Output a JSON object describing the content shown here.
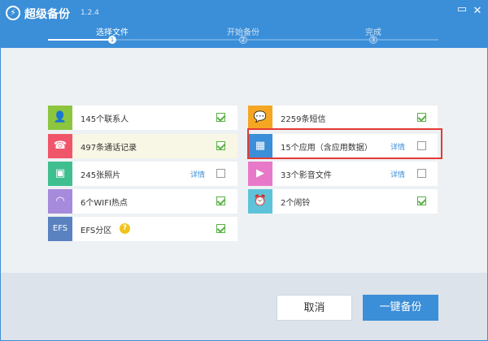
{
  "app": {
    "title": "超级备份",
    "version": "1.2.4",
    "logo": "⚡",
    "minimize_icon": "▭",
    "close_icon": "✕"
  },
  "steps": [
    {
      "label": "选择文件",
      "num": "1"
    },
    {
      "label": "开始备份",
      "num": "2"
    },
    {
      "label": "完成",
      "num": "3"
    }
  ],
  "left_items": [
    {
      "label": "145个联系人",
      "color": "#8cc63f",
      "icon": "contact-icon",
      "glyph": "👤",
      "checked": true
    },
    {
      "label": "497条通话记录",
      "color": "#f0566a",
      "icon": "phone-icon",
      "glyph": "☎",
      "checked": true
    },
    {
      "label": "245张照片",
      "color": "#3fbf8f",
      "icon": "photo-icon",
      "glyph": "▣",
      "detail": "详情",
      "checked": false
    },
    {
      "label": "6个WIFI热点",
      "color": "#a68bdc",
      "icon": "wifi-icon",
      "glyph": "◠",
      "checked": true
    },
    {
      "label": "EFS分区",
      "color": "#5a82c0",
      "icon": "efs-icon",
      "glyph": "EFS",
      "help": "?",
      "checked": true
    }
  ],
  "right_items": [
    {
      "label": "2259条短信",
      "color": "#f5a623",
      "icon": "sms-icon",
      "glyph": "💬",
      "checked": true
    },
    {
      "label": "15个应用（含应用数据）",
      "color": "#3b8ed8",
      "icon": "app-icon",
      "glyph": "▦",
      "detail": "详情",
      "checked": false
    },
    {
      "label": "33个影音文件",
      "color": "#e879c8",
      "icon": "media-icon",
      "glyph": "▶",
      "detail": "详情",
      "checked": false
    },
    {
      "label": "2个闹铃",
      "color": "#5ec3d9",
      "icon": "alarm-icon",
      "glyph": "⏰",
      "checked": true
    }
  ],
  "buttons": {
    "cancel": "取消",
    "backup": "一键备份"
  }
}
